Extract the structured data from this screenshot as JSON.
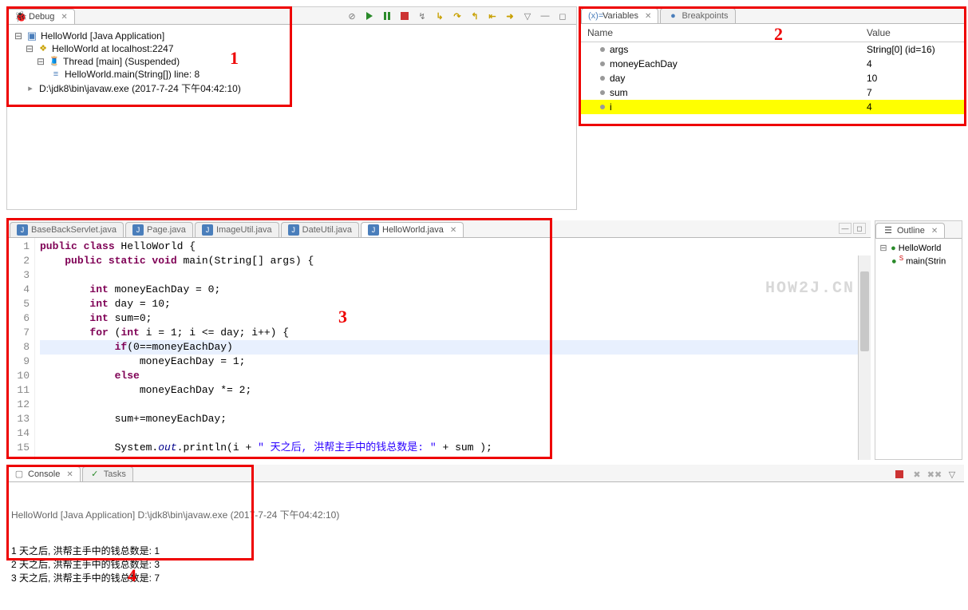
{
  "debug": {
    "tab_label": "Debug",
    "tree": {
      "root": "HelloWorld [Java Application]",
      "node1": "HelloWorld at localhost:2247",
      "node2": "Thread [main] (Suspended)",
      "node3": "HelloWorld.main(String[]) line: 8",
      "node4": "D:\\jdk8\\bin\\javaw.exe (2017-7-24 下午04:42:10)"
    }
  },
  "variables": {
    "tab_vars": "Variables",
    "tab_bps": "Breakpoints",
    "col_name": "Name",
    "col_value": "Value",
    "rows": [
      {
        "name": "args",
        "value": "String[0]  (id=16)"
      },
      {
        "name": "moneyEachDay",
        "value": "4"
      },
      {
        "name": "day",
        "value": "10"
      },
      {
        "name": "sum",
        "value": "7"
      },
      {
        "name": "i",
        "value": "4",
        "hl": true
      }
    ]
  },
  "editor": {
    "tabs": [
      "BaseBackServlet.java",
      "Page.java",
      "ImageUtil.java",
      "DateUtil.java",
      "HelloWorld.java"
    ],
    "active_tab": 4,
    "watermark": "HOW2J.CN",
    "lines": [
      {
        "n": 1,
        "prefix": "",
        "tokens": [
          {
            "t": "public class",
            "c": "kw"
          },
          {
            "t": " HelloWorld {"
          }
        ]
      },
      {
        "n": 2,
        "prefix": "    ",
        "tokens": [
          {
            "t": "public static void",
            "c": "kw"
          },
          {
            "t": " main(String[] args) {"
          }
        ]
      },
      {
        "n": 3,
        "prefix": "",
        "tokens": []
      },
      {
        "n": 4,
        "prefix": "        ",
        "tokens": [
          {
            "t": "int",
            "c": "kw"
          },
          {
            "t": " moneyEachDay = 0;"
          }
        ]
      },
      {
        "n": 5,
        "prefix": "        ",
        "tokens": [
          {
            "t": "int",
            "c": "kw"
          },
          {
            "t": " day = 10;"
          }
        ]
      },
      {
        "n": 6,
        "prefix": "        ",
        "tokens": [
          {
            "t": "int",
            "c": "kw"
          },
          {
            "t": " sum=0;"
          }
        ]
      },
      {
        "n": 7,
        "prefix": "        ",
        "tokens": [
          {
            "t": "for",
            "c": "kw"
          },
          {
            "t": " ("
          },
          {
            "t": "int",
            "c": "kw"
          },
          {
            "t": " i = 1; i <= day; i++) {"
          }
        ]
      },
      {
        "n": 8,
        "prefix": "            ",
        "tokens": [
          {
            "t": "if",
            "c": "kw"
          },
          {
            "t": "(0==moneyEachDay)"
          }
        ],
        "hl": true
      },
      {
        "n": 9,
        "prefix": "                ",
        "tokens": [
          {
            "t": "moneyEachDay = 1;"
          }
        ]
      },
      {
        "n": 10,
        "prefix": "            ",
        "tokens": [
          {
            "t": "else",
            "c": "kw"
          }
        ]
      },
      {
        "n": 11,
        "prefix": "                ",
        "tokens": [
          {
            "t": "moneyEachDay *= 2;"
          }
        ]
      },
      {
        "n": 12,
        "prefix": "",
        "tokens": []
      },
      {
        "n": 13,
        "prefix": "            ",
        "tokens": [
          {
            "t": "sum+=moneyEachDay;"
          }
        ]
      },
      {
        "n": 14,
        "prefix": "",
        "tokens": []
      },
      {
        "n": 15,
        "prefix": "            ",
        "tokens": [
          {
            "t": "System."
          },
          {
            "t": "out",
            "c": "static"
          },
          {
            "t": ".println(i + "
          },
          {
            "t": "\" 天之后, 洪帮主手中的钱总数是: \"",
            "c": "str"
          },
          {
            "t": " + sum );"
          }
        ]
      }
    ]
  },
  "outline": {
    "tab_label": "Outline",
    "root": "HelloWorld",
    "child": "main(Strin"
  },
  "console": {
    "tab_console": "Console",
    "tab_tasks": "Tasks",
    "header": "HelloWorld [Java Application] D:\\jdk8\\bin\\javaw.exe (2017-7-24 下午04:42:10)",
    "lines": [
      "1 天之后, 洪帮主手中的钱总数是: 1",
      "2 天之后, 洪帮主手中的钱总数是: 3",
      "3 天之后, 洪帮主手中的钱总数是: 7"
    ]
  },
  "annotations": {
    "n1": "1",
    "n2": "2",
    "n3": "3",
    "n4": "4"
  }
}
